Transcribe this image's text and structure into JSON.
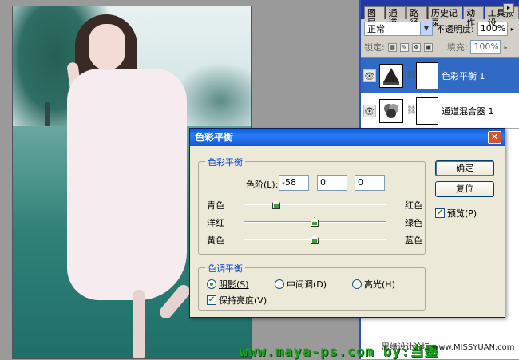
{
  "layers_panel": {
    "tabs": [
      "图层",
      "通道",
      "路径",
      "历史记录",
      "动作",
      "工具预设"
    ],
    "blend_mode": "正常",
    "opacity_label": "不透明度:",
    "opacity_value": "100%",
    "lock_label": "锁定:",
    "fill_label": "填充:",
    "fill_value": "100%",
    "layers": [
      {
        "name": "色彩平衡 1",
        "selected": true
      },
      {
        "name": "通道混合器 1",
        "selected": false
      }
    ]
  },
  "dialog": {
    "title": "色彩平衡",
    "color_balance_group": "色彩平衡",
    "levels_label": "色阶(L):",
    "levels": [
      "-58",
      "0",
      "0"
    ],
    "sliders": [
      {
        "left": "青色",
        "right": "红色",
        "value": -58
      },
      {
        "left": "洋红",
        "right": "绿色",
        "value": 0
      },
      {
        "left": "黄色",
        "right": "蓝色",
        "value": 0
      }
    ],
    "tone_group": "色调平衡",
    "tones": [
      "阴影(S)",
      "中间调(D)",
      "高光(H)"
    ],
    "selected_tone": "阴影(S)",
    "preserve_luminosity": "保持亮度(V)",
    "ok_button": "确定",
    "reset_button": "复位",
    "preview_label": "预览(P)"
  },
  "watermark": {
    "site": "www.maya-ps.com  by:当墨",
    "forum": "思缘设计论坛 www.MISSYUAN.com"
  },
  "colors": {
    "title_bar": "#1557d6",
    "selected_layer": "#316ac5",
    "watermark_green": "#1aa31a"
  }
}
